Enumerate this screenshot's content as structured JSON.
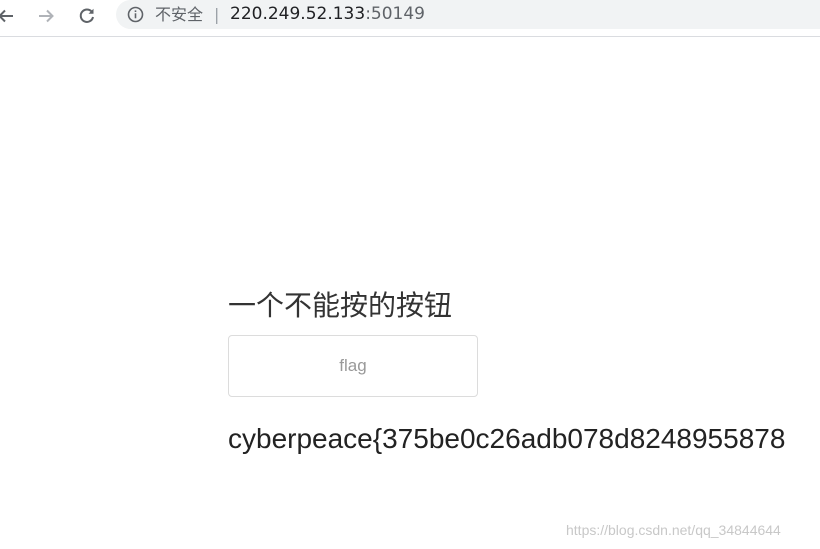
{
  "browser": {
    "security_label": "不安全",
    "separator": "|",
    "url_host": "220.249.52.133",
    "url_port": ":50149",
    "icons": {
      "back": "arrow-left-icon",
      "forward": "arrow-right-icon",
      "reload": "reload-icon",
      "info": "info-icon"
    }
  },
  "page": {
    "title": "一个不能按的按钮",
    "button_label": "flag",
    "flag_text": "cyberpeace{375be0c26adb078d8248955878",
    "watermark": "https://blog.csdn.net/qq_34844644"
  },
  "colors": {
    "omnibox_bg": "#f1f3f4",
    "button_border": "#dcdcdc",
    "button_text": "#999999"
  }
}
